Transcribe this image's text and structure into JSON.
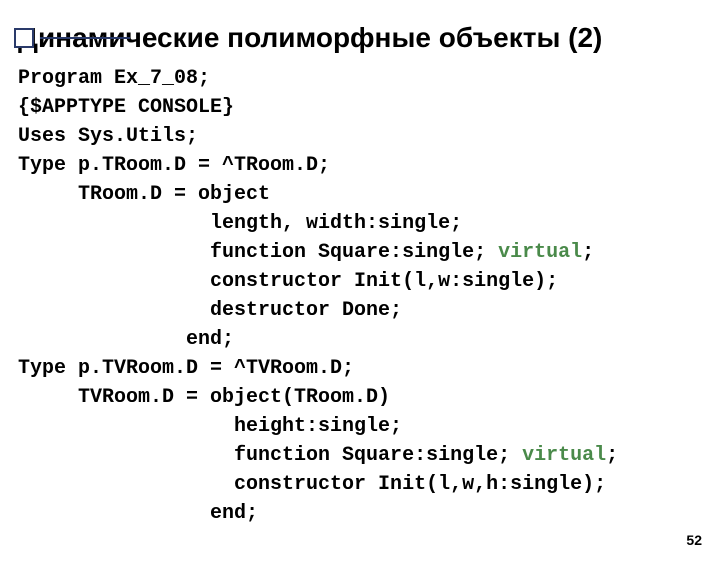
{
  "title": "Динамические полиморфные объекты (2)",
  "page_number": "52",
  "code": {
    "l1": "Program Ex_7_08;",
    "l2": "{$APPTYPE CONSOLE}",
    "l3": "Uses Sys.Utils;",
    "l4": "Type p.TRoom.D = ^TRoom.D;",
    "l5": "     TRoom.D = object",
    "l6": "                length, width:single;",
    "l7a": "                function Square:single; ",
    "l7b": "virtual",
    "l7c": ";",
    "l8": "                constructor Init(l,w:single);",
    "l9": "                destructor Done;",
    "l10": "              end;",
    "l11": "Type p.TVRoom.D = ^TVRoom.D;",
    "l12": "     TVRoom.D = object(TRoom.D)",
    "l13": "                  height:single;",
    "l14a": "                  function Square:single; ",
    "l14b": "virtual",
    "l14c": ";",
    "l15": "                  constructor Init(l,w,h:single);",
    "l16": "                end;"
  }
}
